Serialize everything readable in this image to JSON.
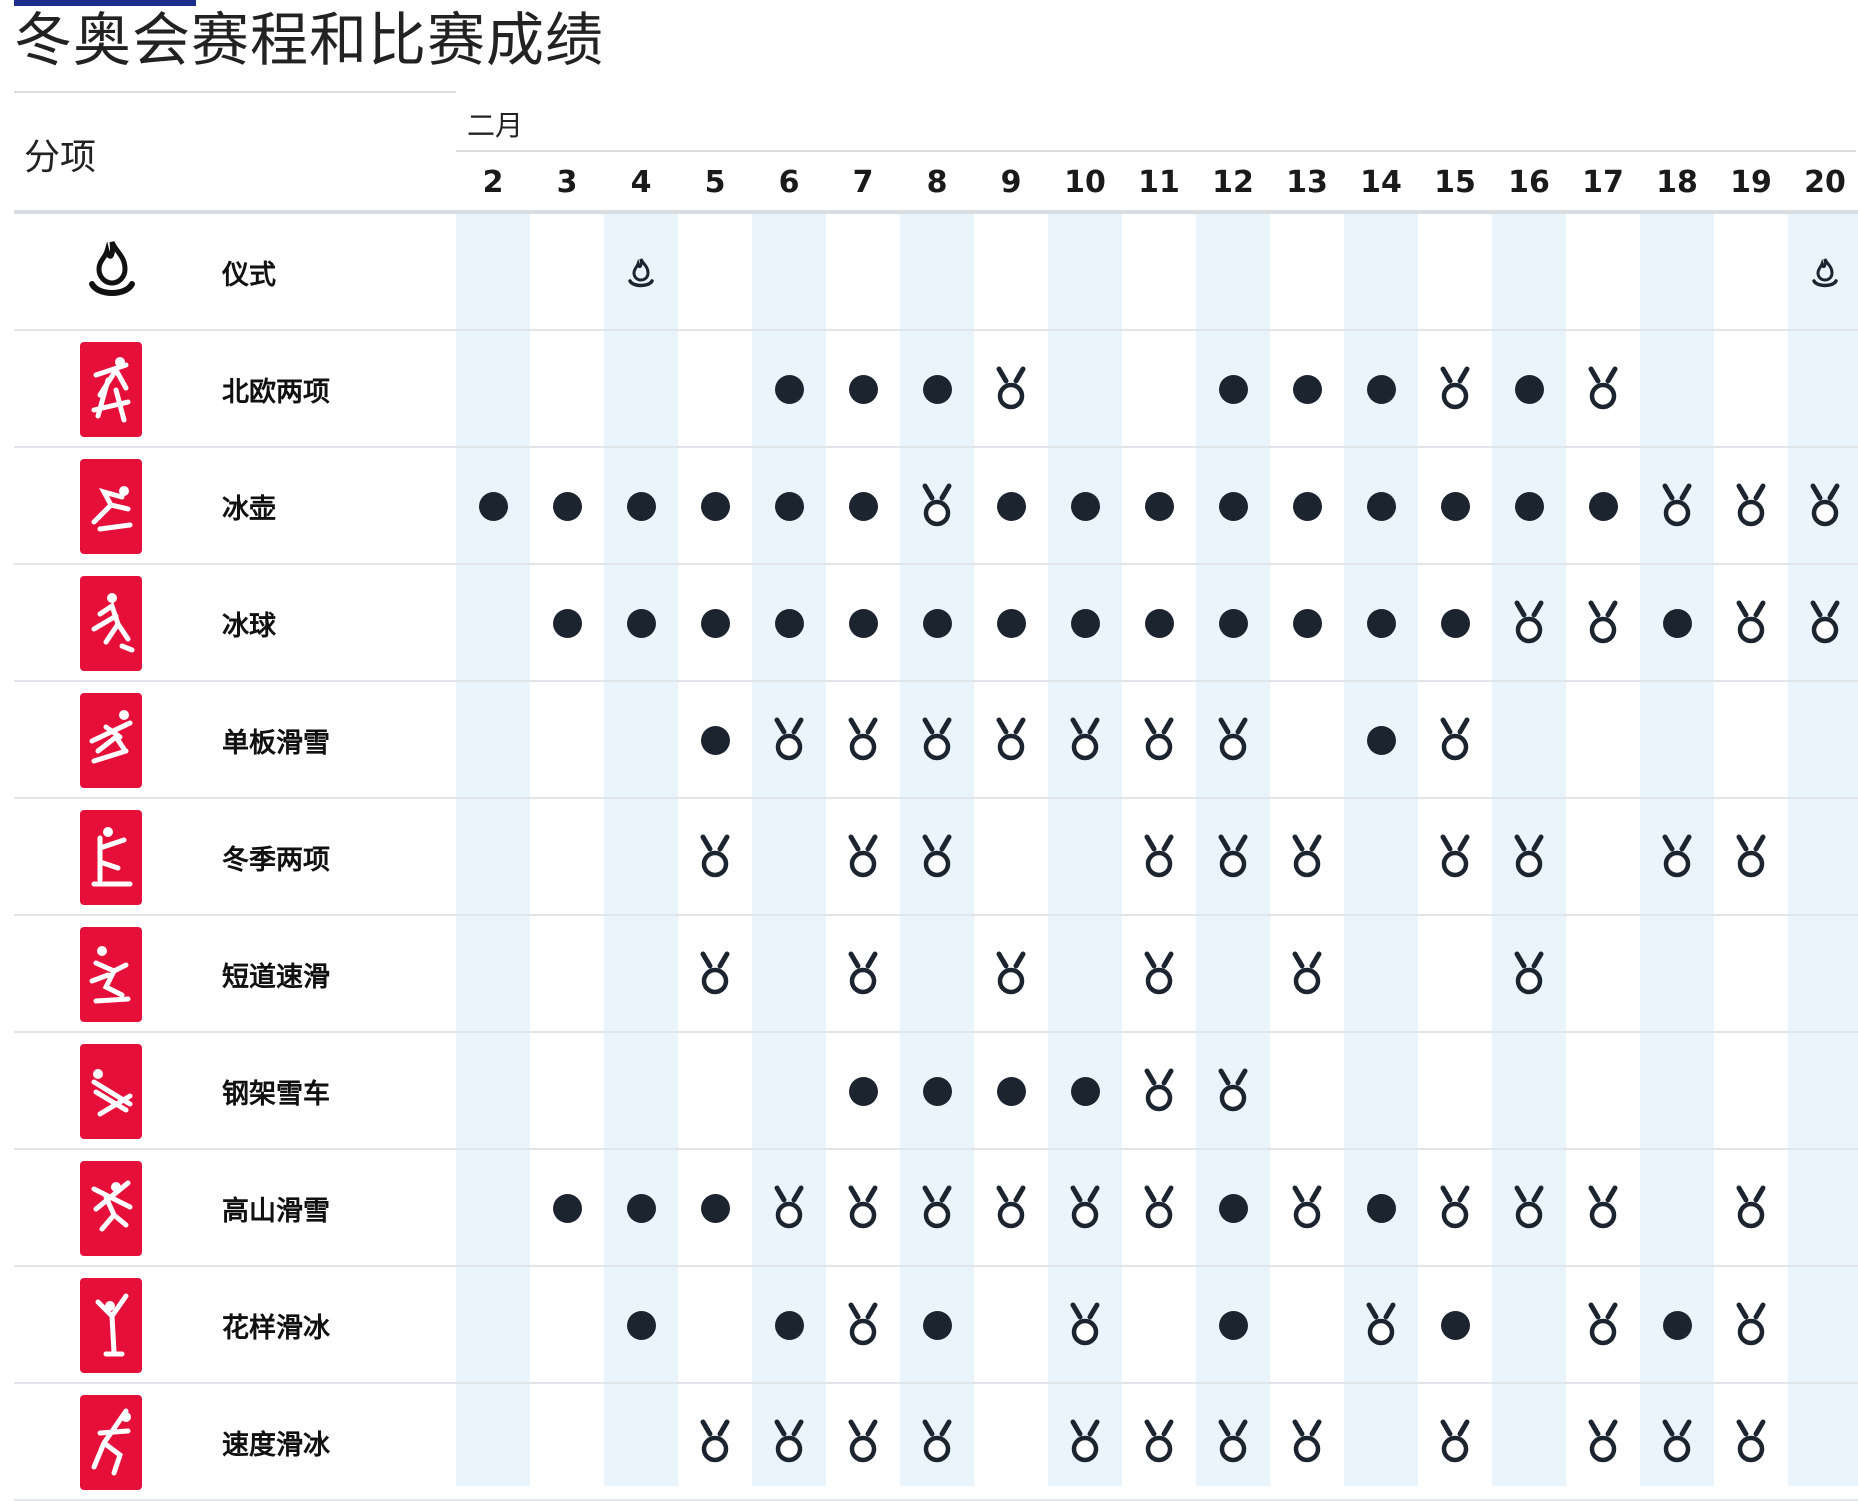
{
  "page": {
    "title": "冬奥会赛程和比赛成绩",
    "month_label": "二月",
    "sport_column_header": "分项"
  },
  "days": [
    "2",
    "3",
    "4",
    "5",
    "6",
    "7",
    "8",
    "9",
    "10",
    "11",
    "12",
    "13",
    "14",
    "15",
    "16",
    "17",
    "18",
    "19",
    "20"
  ],
  "shaded_days": [
    "2",
    "4",
    "6",
    "8",
    "10",
    "12",
    "14",
    "16",
    "18",
    "20"
  ],
  "legend_meaning": {
    "dot": "competition-day",
    "medal": "medal-event-day",
    "flame": "ceremony"
  },
  "colors": {
    "pictogram_bg": "#e60f3a",
    "dot": "#1c2430",
    "column_shade": "#e9f4fc",
    "top_bar": "#1c2f8f"
  },
  "sports": [
    {
      "name": "仪式",
      "icon": "flame-icon",
      "schedule": {
        "4": "flame",
        "20": "flame"
      }
    },
    {
      "name": "北欧两项",
      "icon": "nordic-combined-icon",
      "schedule": {
        "6": "dot",
        "7": "dot",
        "8": "dot",
        "9": "medal",
        "12": "dot",
        "13": "dot",
        "14": "dot",
        "15": "medal",
        "16": "dot",
        "17": "medal"
      }
    },
    {
      "name": "冰壶",
      "icon": "curling-icon",
      "schedule": {
        "2": "dot",
        "3": "dot",
        "4": "dot",
        "5": "dot",
        "6": "dot",
        "7": "dot",
        "8": "medal",
        "9": "dot",
        "10": "dot",
        "11": "dot",
        "12": "dot",
        "13": "dot",
        "14": "dot",
        "15": "dot",
        "16": "dot",
        "17": "dot",
        "18": "medal",
        "19": "medal",
        "20": "medal"
      }
    },
    {
      "name": "冰球",
      "icon": "ice-hockey-icon",
      "schedule": {
        "3": "dot",
        "4": "dot",
        "5": "dot",
        "6": "dot",
        "7": "dot",
        "8": "dot",
        "9": "dot",
        "10": "dot",
        "11": "dot",
        "12": "dot",
        "13": "dot",
        "14": "dot",
        "15": "dot",
        "16": "medal",
        "17": "medal",
        "18": "dot",
        "19": "medal",
        "20": "medal"
      }
    },
    {
      "name": "单板滑雪",
      "icon": "snowboard-icon",
      "schedule": {
        "5": "dot",
        "6": "medal",
        "7": "medal",
        "8": "medal",
        "9": "medal",
        "10": "medal",
        "11": "medal",
        "12": "medal",
        "14": "dot",
        "15": "medal"
      }
    },
    {
      "name": "冬季两项",
      "icon": "biathlon-icon",
      "schedule": {
        "5": "medal",
        "7": "medal",
        "8": "medal",
        "11": "medal",
        "12": "medal",
        "13": "medal",
        "15": "medal",
        "16": "medal",
        "18": "medal",
        "19": "medal"
      }
    },
    {
      "name": "短道速滑",
      "icon": "short-track-icon",
      "schedule": {
        "5": "medal",
        "7": "medal",
        "9": "medal",
        "11": "medal",
        "13": "medal",
        "16": "medal"
      }
    },
    {
      "name": "钢架雪车",
      "icon": "skeleton-icon",
      "schedule": {
        "7": "dot",
        "8": "dot",
        "9": "dot",
        "10": "dot",
        "11": "medal",
        "12": "medal"
      }
    },
    {
      "name": "高山滑雪",
      "icon": "alpine-skiing-icon",
      "schedule": {
        "3": "dot",
        "4": "dot",
        "5": "dot",
        "6": "medal",
        "7": "medal",
        "8": "medal",
        "9": "medal",
        "10": "medal",
        "11": "medal",
        "12": "dot",
        "13": "medal",
        "14": "dot",
        "15": "medal",
        "16": "medal",
        "17": "medal",
        "19": "medal"
      }
    },
    {
      "name": "花样滑冰",
      "icon": "figure-skating-icon",
      "schedule": {
        "4": "dot",
        "6": "dot",
        "7": "medal",
        "8": "dot",
        "10": "medal",
        "12": "dot",
        "14": "medal",
        "15": "dot",
        "17": "medal",
        "18": "dot",
        "19": "medal"
      }
    },
    {
      "name": "速度滑冰",
      "icon": "speed-skating-icon",
      "schedule": {
        "5": "medal",
        "6": "medal",
        "7": "medal",
        "8": "medal",
        "10": "medal",
        "11": "medal",
        "12": "medal",
        "13": "medal",
        "15": "medal",
        "17": "medal",
        "18": "medal",
        "19": "medal"
      }
    }
  ]
}
